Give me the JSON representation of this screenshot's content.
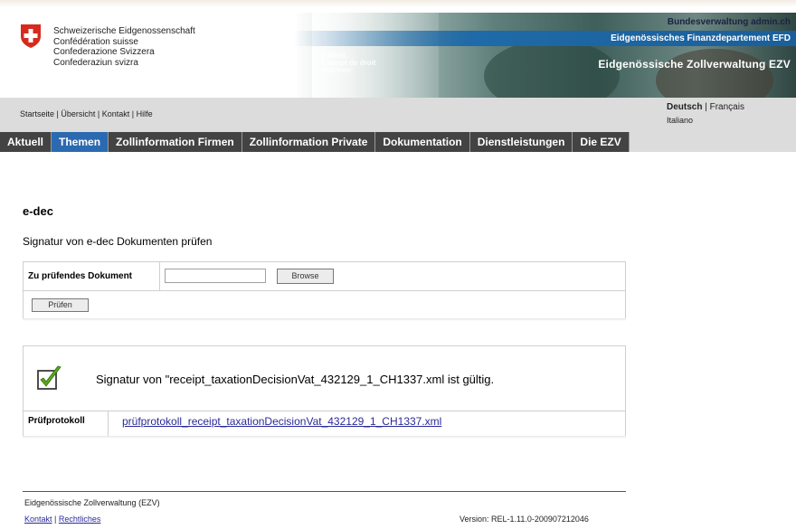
{
  "header": {
    "confederation_lines": [
      "Schweizerische Eidgenossenschaft",
      "Confédération suisse",
      "Confederazione Svizzera",
      "Confederaziun svizra"
    ],
    "admin_label": "Bundesverwaltung admin.ch",
    "department_label": "Eidgenössisches Finanzdepartement EFD",
    "office_label": "Eidgenössische Zollverwaltung EZV",
    "banner_sign_lines": [
      "Zollfrei:",
      "Exempt de droit",
      "Dutyfree:"
    ]
  },
  "service_nav": {
    "links": [
      "Startseite",
      "Übersicht",
      "Kontakt",
      "Hilfe"
    ],
    "separator": " | "
  },
  "languages": {
    "active": "Deutsch",
    "separator": " | ",
    "others": [
      "Français",
      "Italiano"
    ]
  },
  "main_nav": {
    "items": [
      {
        "label": "Aktuell"
      },
      {
        "label": "Themen"
      },
      {
        "label": "Zollinformation Firmen"
      },
      {
        "label": "Zollinformation Private"
      },
      {
        "label": "Dokumentation"
      },
      {
        "label": "Dienstleistungen"
      },
      {
        "label": "Die EZV"
      }
    ],
    "active_index": 1,
    "active_color": "#2b6ab0",
    "bar_color": "#434343"
  },
  "content": {
    "title": "e-dec",
    "subtitle": "Signatur von e-dec Dokumenten prüfen",
    "form": {
      "document_label": "Zu prüfendes Dokument",
      "file_value": "",
      "browse_label": "Browse",
      "check_label": "Prüfen"
    },
    "result": {
      "status": "valid",
      "message": "Signatur von \"receipt_taxationDecisionVat_432129_1_CH1337.xml ist gültig.",
      "protocol_label": "Prüfprotokoll",
      "protocol_link": "prüfprotokoll_receipt_taxationDecisionVat_432129_1_CH1337.xml"
    }
  },
  "footer": {
    "organization": "Eidgenössische Zollverwaltung (EZV)",
    "links": [
      "Kontakt",
      "Rechtliches"
    ],
    "separator": " | ",
    "version": "Version:  REL-1.11.0-200907212046"
  },
  "colors": {
    "swiss_red": "#d52b1e",
    "link": "#2a2a9a",
    "check_green": "#5aa61e"
  }
}
